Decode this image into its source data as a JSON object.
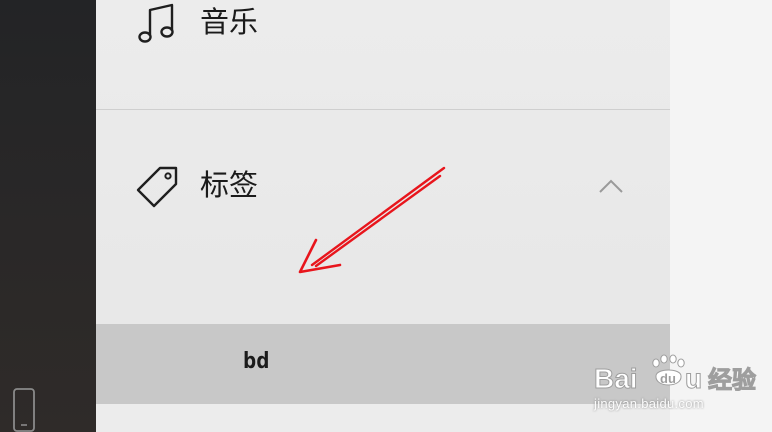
{
  "panel": {
    "music_label": "音乐",
    "tags_label": "标签",
    "tag_item_label": "bd"
  },
  "icons": {
    "music": "music-note-icon",
    "tag": "tag-icon",
    "collapse": "chevron-up-icon",
    "device": "phone-icon"
  },
  "colors": {
    "annotation_arrow": "#e8151c",
    "selected_row_bg": "#c8c8c8",
    "panel_bg": "#ececec",
    "left_rail_bg": "#262626"
  },
  "watermark": {
    "logo_text": "Bai du 经验",
    "url": "jingyan.baidu.com"
  }
}
